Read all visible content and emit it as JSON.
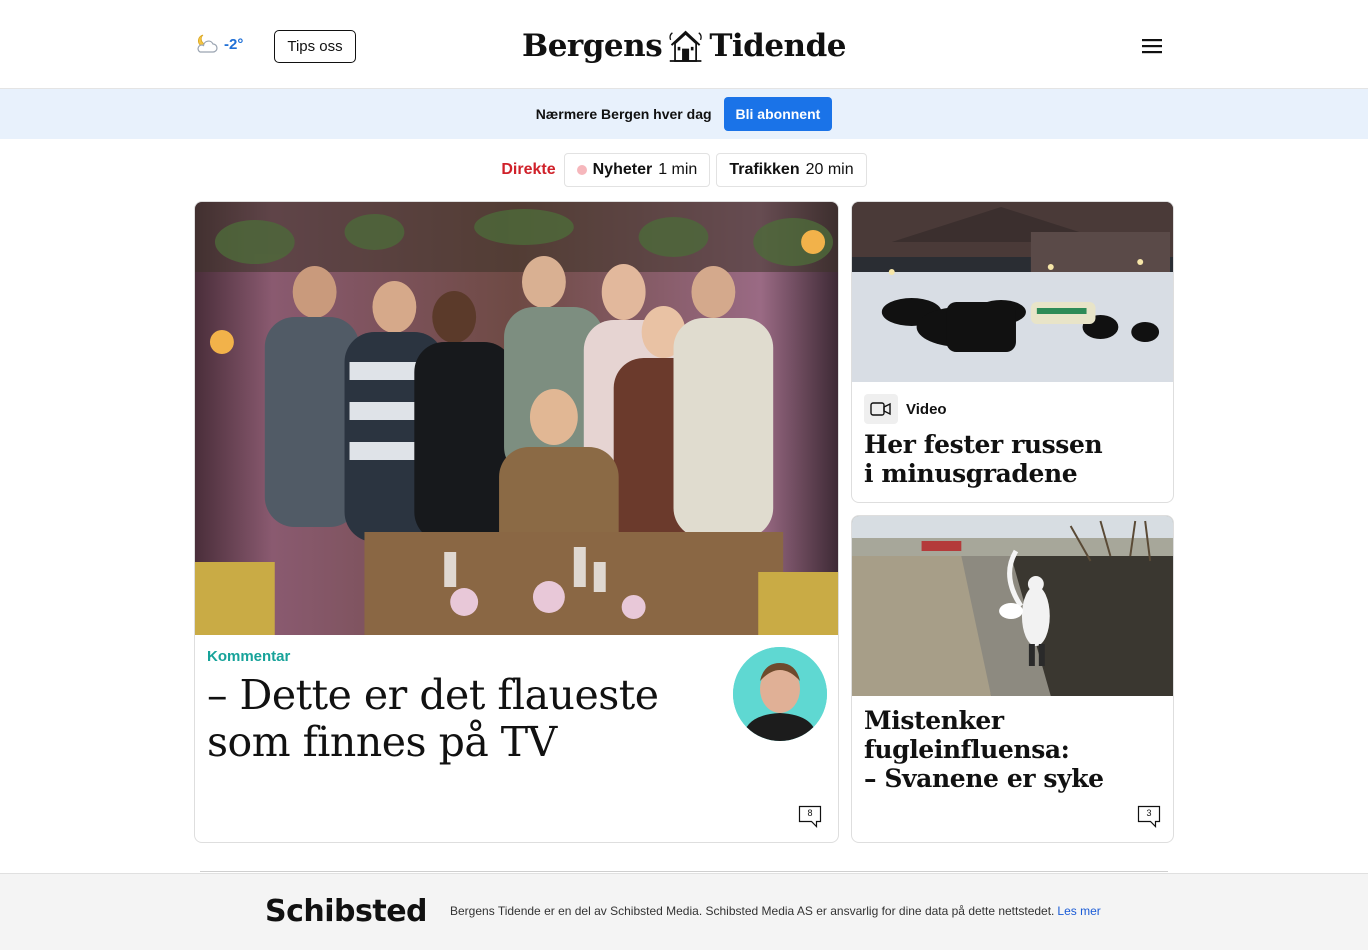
{
  "header": {
    "weather_temp": "-2°",
    "weather_icon": "partly-cloudy-night-icon",
    "tips_label": "Tips oss",
    "logo_left": "Bergens",
    "logo_right": "Tidende",
    "menu_icon": "hamburger-menu-icon"
  },
  "banner": {
    "text": "Nærmere Bergen hver dag",
    "cta": "Bli abonnent",
    "accent": "#1a73e8",
    "background": "#e8f1fc"
  },
  "live": {
    "label": "Direkte",
    "chips": [
      {
        "name": "Nyheter",
        "time": "1 min"
      },
      {
        "name": "Trafikken",
        "time": "20 min"
      }
    ]
  },
  "main_article": {
    "kicker": "Kommentar",
    "headline_line1": "– Dette er det flaueste",
    "headline_line2": "som finnes på TV",
    "comments": "8",
    "kicker_color": "#17a39a"
  },
  "side_articles": [
    {
      "tag": "Video",
      "headline_line1": "Her fester russen",
      "headline_line2": "i minusgradene"
    },
    {
      "headline_line1": "Mistenker",
      "headline_line2": "fugleinfluensa:",
      "headline_line3": "– Svanene er syke",
      "comments": "3"
    }
  ],
  "footer": {
    "brand": "Schibsted",
    "text": "Bergens Tidende er en del av Schibsted Media. Schibsted Media AS er ansvarlig for dine data på dette nettstedet.",
    "link": "Les mer"
  }
}
